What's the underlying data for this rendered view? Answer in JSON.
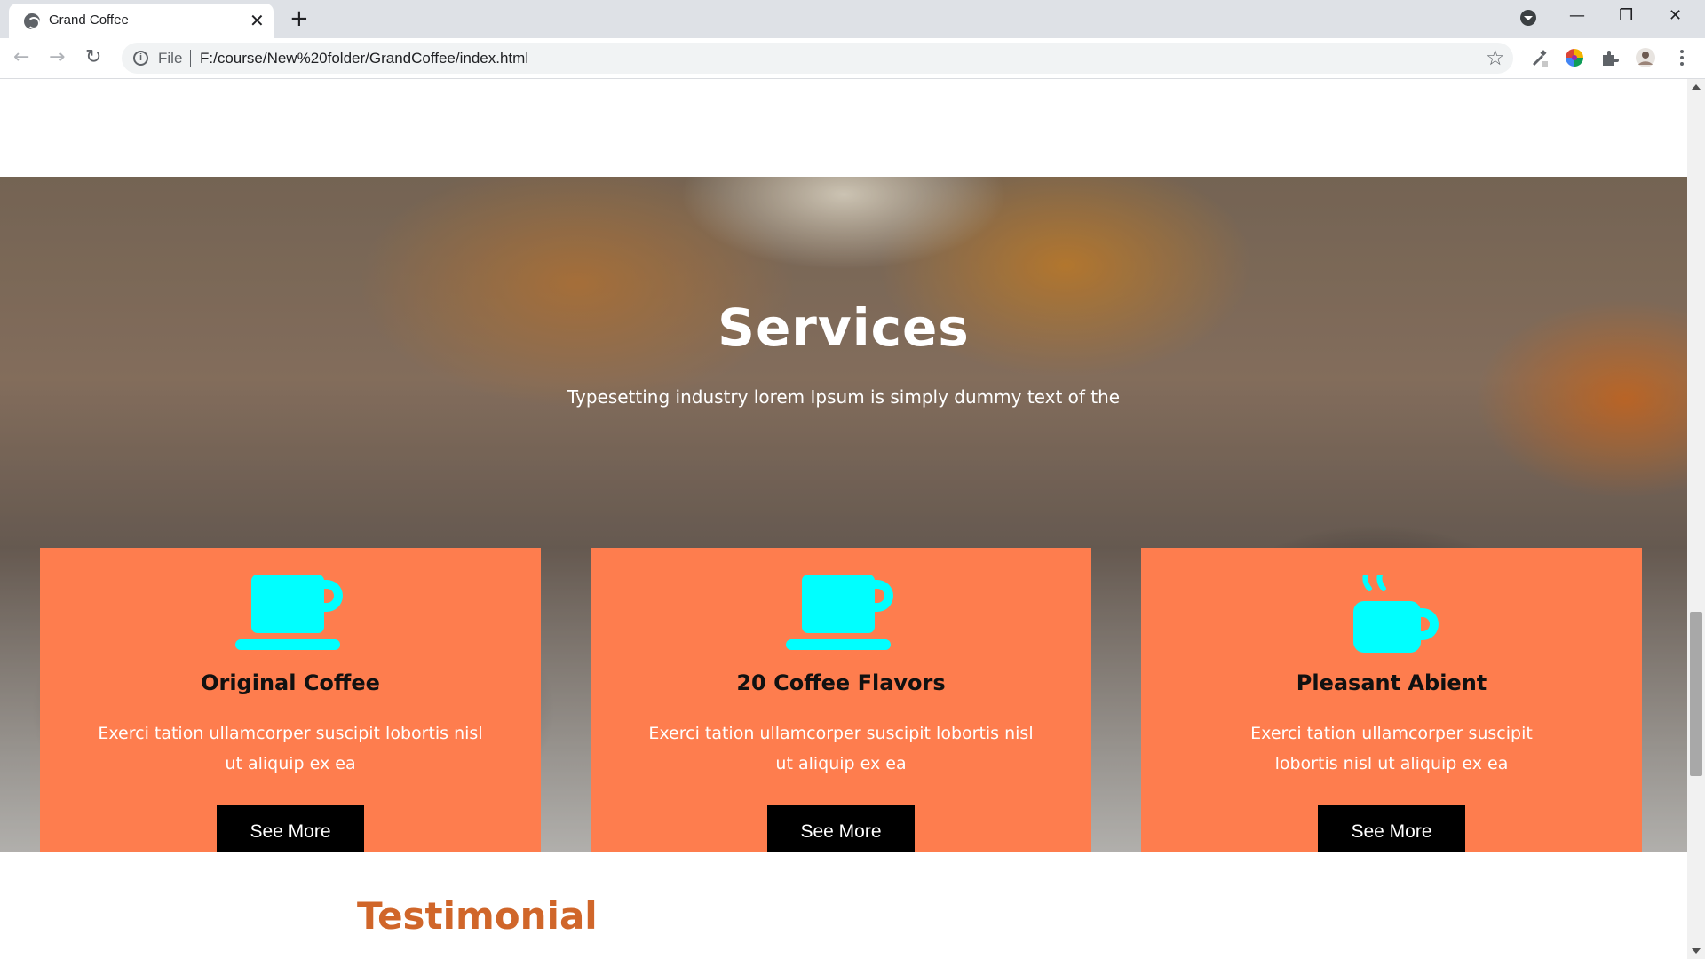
{
  "browser": {
    "tab_title": "Grand Coffee",
    "tab_close": "✕",
    "new_tab": "+",
    "scheme": "File",
    "url": "F:/course/New%20folder/GrandCoffee/index.html",
    "back": "←",
    "forward": "→",
    "reload": "↻",
    "star": "☆",
    "minimize": "—",
    "maximize": "❐",
    "close": "✕"
  },
  "services": {
    "title": "Services",
    "subtitle": "Typesetting industry lorem Ipsum is simply dummy text of the",
    "cards": [
      {
        "icon": "coffee-cup-icon",
        "title": "Original Coffee",
        "text": "Exerci tation ullamcorper suscipit lobortis nisl ut aliquip ex ea",
        "button": "See More"
      },
      {
        "icon": "coffee-cup-icon",
        "title": "20 Coffee Flavors",
        "text": "Exerci tation ullamcorper suscipit lobortis nisl ut aliquip ex ea",
        "button": "See More"
      },
      {
        "icon": "hot-coffee-mug-icon",
        "title": "Pleasant Abient",
        "text": "Exerci tation ullamcorper suscipit lobortis nisl ut aliquip ex ea",
        "button": "See More"
      }
    ]
  },
  "testimonial": {
    "title": "Testimonial"
  },
  "colors": {
    "card_bg": "#fe7d4e",
    "icon": "#00ffff",
    "button_bg": "#000000",
    "testimonial_title": "#d0662a"
  }
}
